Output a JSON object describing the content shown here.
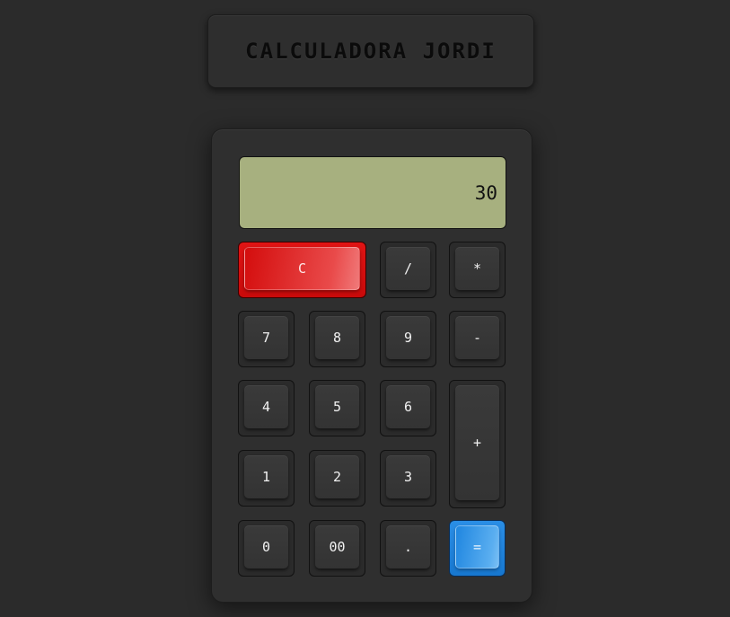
{
  "title": "CALCULADORA JORDI",
  "display": {
    "value": "30"
  },
  "keys": {
    "clear": "C",
    "divide": "/",
    "multiply": "*",
    "seven": "7",
    "eight": "8",
    "nine": "9",
    "minus": "-",
    "four": "4",
    "five": "5",
    "six": "6",
    "plus": "+",
    "one": "1",
    "two": "2",
    "three": "3",
    "zero": "0",
    "double_zero": "00",
    "decimal": ".",
    "equals": "="
  },
  "colors": {
    "background": "#2b2b2b",
    "display": "#a7b07f",
    "clear_key": "#d40d0d",
    "equals_key": "#1f86e0"
  }
}
